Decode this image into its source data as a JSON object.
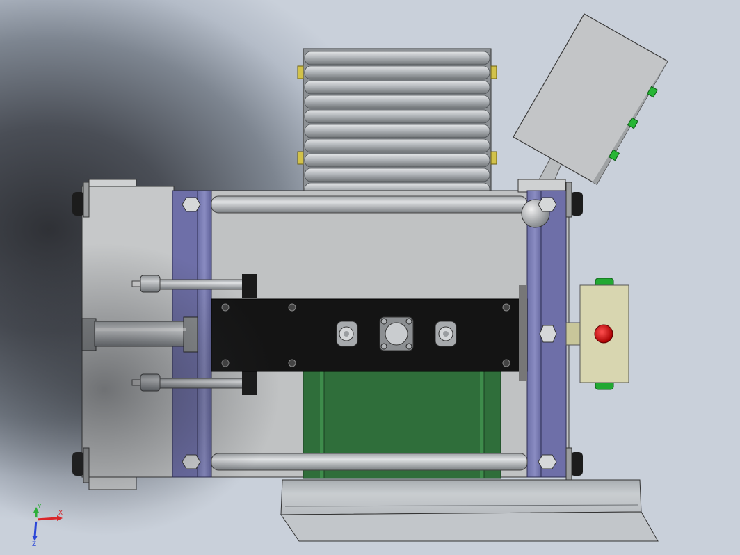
{
  "triad": {
    "x_label": "X",
    "y_label": "Y",
    "z_label": "Z"
  },
  "colors": {
    "frame": "#c4c6c6",
    "plate": "#6e6fa8",
    "black_plate": "#141414",
    "green": "#2f6e3a",
    "roller": "#b7bcbf",
    "indicator": "#d8d6b0",
    "red_button": "#d11515",
    "fitting": "#22a832"
  }
}
